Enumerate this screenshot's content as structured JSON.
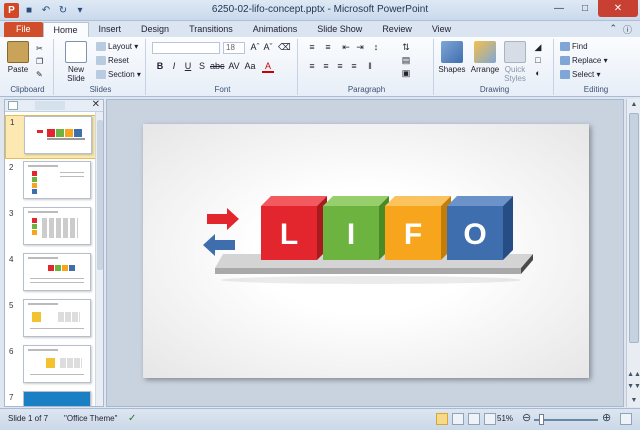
{
  "window": {
    "title": "6250-02-lifo-concept.pptx - Microsoft PowerPoint",
    "app_icon_letter": "P"
  },
  "tabs": [
    "File",
    "Home",
    "Insert",
    "Design",
    "Transitions",
    "Animations",
    "Slide Show",
    "Review",
    "View"
  ],
  "active_tab": "Home",
  "ribbon": {
    "clipboard": {
      "label": "Clipboard",
      "paste": "Paste"
    },
    "slides": {
      "label": "Slides",
      "new_slide": "New Slide",
      "layout": "Layout",
      "reset": "Reset",
      "section": "Section"
    },
    "font": {
      "label": "Font",
      "font_name": "",
      "font_size": "18"
    },
    "paragraph": {
      "label": "Paragraph"
    },
    "drawing": {
      "label": "Drawing",
      "shapes": "Shapes",
      "arrange": "Arrange",
      "quick_styles": "Quick Styles"
    },
    "editing": {
      "label": "Editing",
      "find": "Find",
      "replace": "Replace",
      "select": "Select"
    }
  },
  "thumbnails": [
    {
      "number": "1",
      "selected": true
    },
    {
      "number": "2",
      "selected": false
    },
    {
      "number": "3",
      "selected": false
    },
    {
      "number": "4",
      "selected": false
    },
    {
      "number": "5",
      "selected": false
    },
    {
      "number": "6",
      "selected": false
    },
    {
      "number": "7",
      "selected": false
    }
  ],
  "slide": {
    "letters": [
      "L",
      "I",
      "F",
      "O"
    ],
    "cube_colors": [
      "#e3262d",
      "#6db33f",
      "#f7a51c",
      "#3f6eae"
    ],
    "arrow_in_color": "#e3262d",
    "arrow_out_color": "#3f6eae"
  },
  "status": {
    "slide_info": "Slide 1 of 7",
    "theme": "\"Office Theme\"",
    "zoom": "51%"
  }
}
